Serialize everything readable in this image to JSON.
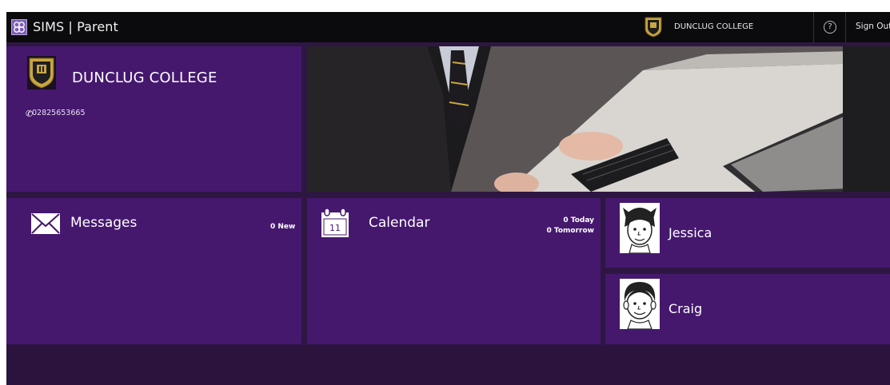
{
  "topbar": {
    "app_title": "SIMS | Parent",
    "school_name": "DUNCLUG COLLEGE",
    "help_glyph": "?",
    "sign_out": "Sign Out"
  },
  "school": {
    "name": "DUNCLUG COLLEGE",
    "phone_glyph": "✆",
    "phone": "02825653665"
  },
  "tiles": {
    "messages": {
      "label": "Messages",
      "badge": "0 New",
      "icon": "envelope-icon"
    },
    "calendar": {
      "label": "Calendar",
      "day": "11",
      "today": "0 Today",
      "tomorrow": "0 Tomorrow",
      "icon": "calendar-icon"
    }
  },
  "children": [
    {
      "name": "Jessica",
      "icon": "girl-avatar"
    },
    {
      "name": "Craig",
      "icon": "boy-avatar"
    }
  ],
  "colors": {
    "topbar": "#0b0a0d",
    "tile": "#45186e",
    "background_band": "#2e1643"
  }
}
